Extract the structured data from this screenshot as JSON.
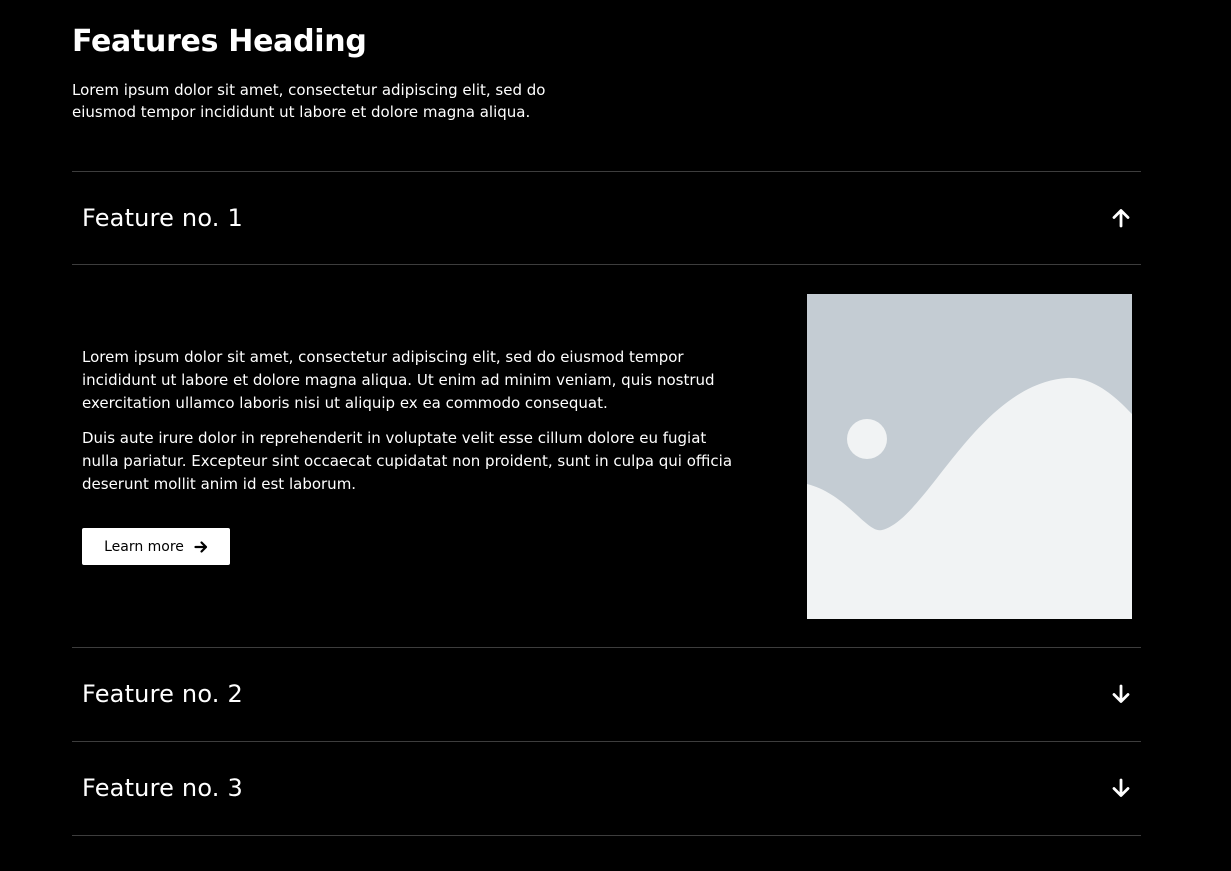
{
  "header": {
    "title": "Features Heading",
    "intro": "Lorem ipsum dolor sit amet, consectetur adipiscing elit, sed do eiusmod tempor incididunt ut labore et dolore magna aliqua."
  },
  "features": [
    {
      "title": "Feature no. 1",
      "expanded": true,
      "icon": "arrow-up-icon",
      "paragraphs": [
        "Lorem ipsum dolor sit amet, consectetur adipiscing elit, sed do eiusmod tempor incididunt ut labore et dolore magna aliqua. Ut enim ad minim veniam, quis nostrud exercitation ullamco laboris nisi ut aliquip ex ea commodo consequat.",
        "Duis aute irure dolor in reprehenderit in voluptate velit esse cillum dolore eu fugiat nulla pariatur. Excepteur sint occaecat cupidatat non proident, sunt in culpa qui officia deserunt mollit anim id est laborum."
      ],
      "button_label": "Learn more",
      "button_icon": "arrow-right-icon",
      "image_icon": "image-placeholder-icon"
    },
    {
      "title": "Feature no. 2",
      "expanded": false,
      "icon": "arrow-down-icon"
    },
    {
      "title": "Feature no. 3",
      "expanded": false,
      "icon": "arrow-down-icon"
    }
  ],
  "colors": {
    "background": "#000000",
    "text": "#ffffff",
    "divider": "#3d3d3d",
    "button_bg": "#ffffff",
    "button_text": "#000000",
    "placeholder_sky": "#c4ccd3",
    "placeholder_ground": "#f1f3f4"
  }
}
